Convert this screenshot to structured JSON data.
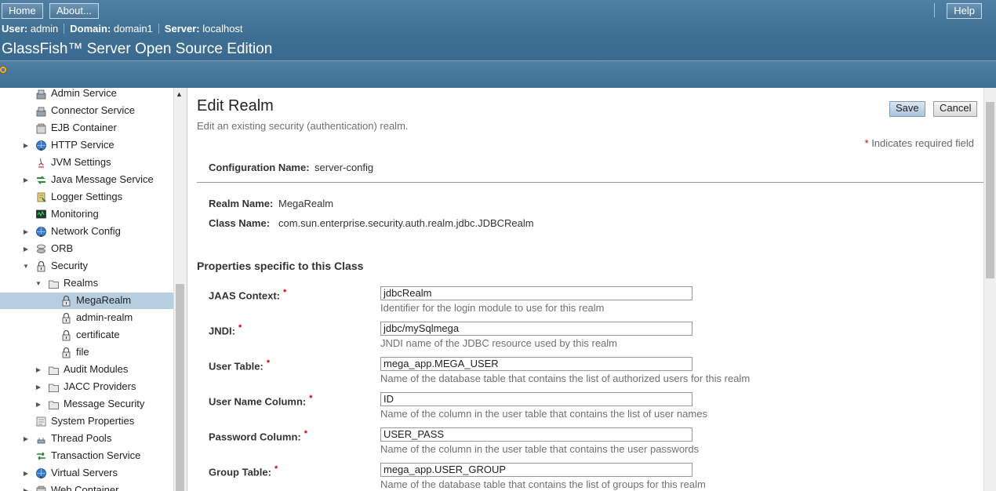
{
  "masthead": {
    "home": "Home",
    "about": "About...",
    "help": "Help",
    "user_label": "User:",
    "user_value": "admin",
    "domain_label": "Domain:",
    "domain_value": "domain1",
    "server_label": "Server:",
    "server_value": "localhost",
    "product": "GlassFish™ Server Open Source Edition"
  },
  "nav": {
    "items": [
      {
        "label": "Admin Service",
        "icon": "service-icon"
      },
      {
        "label": "Connector Service",
        "icon": "service-icon"
      },
      {
        "label": "EJB Container",
        "icon": "container-icon"
      },
      {
        "label": "HTTP Service",
        "icon": "globe-icon"
      },
      {
        "label": "JVM Settings",
        "icon": "java-icon"
      },
      {
        "label": "Java Message Service",
        "icon": "message-icon"
      },
      {
        "label": "Logger Settings",
        "icon": "logger-icon"
      },
      {
        "label": "Monitoring",
        "icon": "monitor-icon"
      },
      {
        "label": "Network Config",
        "icon": "globe-icon"
      },
      {
        "label": "ORB",
        "icon": "orb-icon"
      },
      {
        "label": "Security",
        "icon": "lock-icon"
      },
      {
        "label": "Realms",
        "icon": "folder-icon"
      },
      {
        "label": "MegaRealm",
        "icon": "lock-icon"
      },
      {
        "label": "admin-realm",
        "icon": "lock-icon"
      },
      {
        "label": "certificate",
        "icon": "lock-icon"
      },
      {
        "label": "file",
        "icon": "lock-icon"
      },
      {
        "label": "Audit Modules",
        "icon": "folder-icon"
      },
      {
        "label": "JACC Providers",
        "icon": "folder-icon"
      },
      {
        "label": "Message Security",
        "icon": "folder-icon"
      },
      {
        "label": "System Properties",
        "icon": "properties-icon"
      },
      {
        "label": "Thread Pools",
        "icon": "threads-icon"
      },
      {
        "label": "Transaction Service",
        "icon": "transaction-icon"
      },
      {
        "label": "Virtual Servers",
        "icon": "globe-icon"
      },
      {
        "label": "Web Container",
        "icon": "container-icon"
      }
    ]
  },
  "page": {
    "title": "Edit Realm",
    "help": "Edit an existing security (authentication) realm.",
    "save": "Save",
    "cancel": "Cancel",
    "required_star": "*",
    "required_text": " Indicates required field",
    "config_label": "Configuration Name:",
    "config_value": "server-config",
    "realm_label": "Realm Name:",
    "realm_value": "MegaRealm",
    "class_label": "Class Name:",
    "class_value": "com.sun.enterprise.security.auth.realm.jdbc.JDBCRealm",
    "props_heading": "Properties specific to this Class"
  },
  "fields": [
    {
      "label": "JAAS Context:",
      "value": "jdbcRealm",
      "help": "Identifier for the login module to use for this realm"
    },
    {
      "label": "JNDI:",
      "value": "jdbc/mySqlmega",
      "help": "JNDI name of the JDBC resource used by this realm"
    },
    {
      "label": "User Table:",
      "value": "mega_app.MEGA_USER",
      "help": "Name of the database table that contains the list of authorized users for this realm"
    },
    {
      "label": "User Name Column:",
      "value": "ID",
      "help": "Name of the column in the user table that contains the list of user names"
    },
    {
      "label": "Password Column:",
      "value": "USER_PASS",
      "help": "Name of the column in the user table that contains the user passwords"
    },
    {
      "label": "Group Table:",
      "value": "mega_app.USER_GROUP",
      "help": "Name of the database table that contains the list of groups for this realm"
    }
  ]
}
